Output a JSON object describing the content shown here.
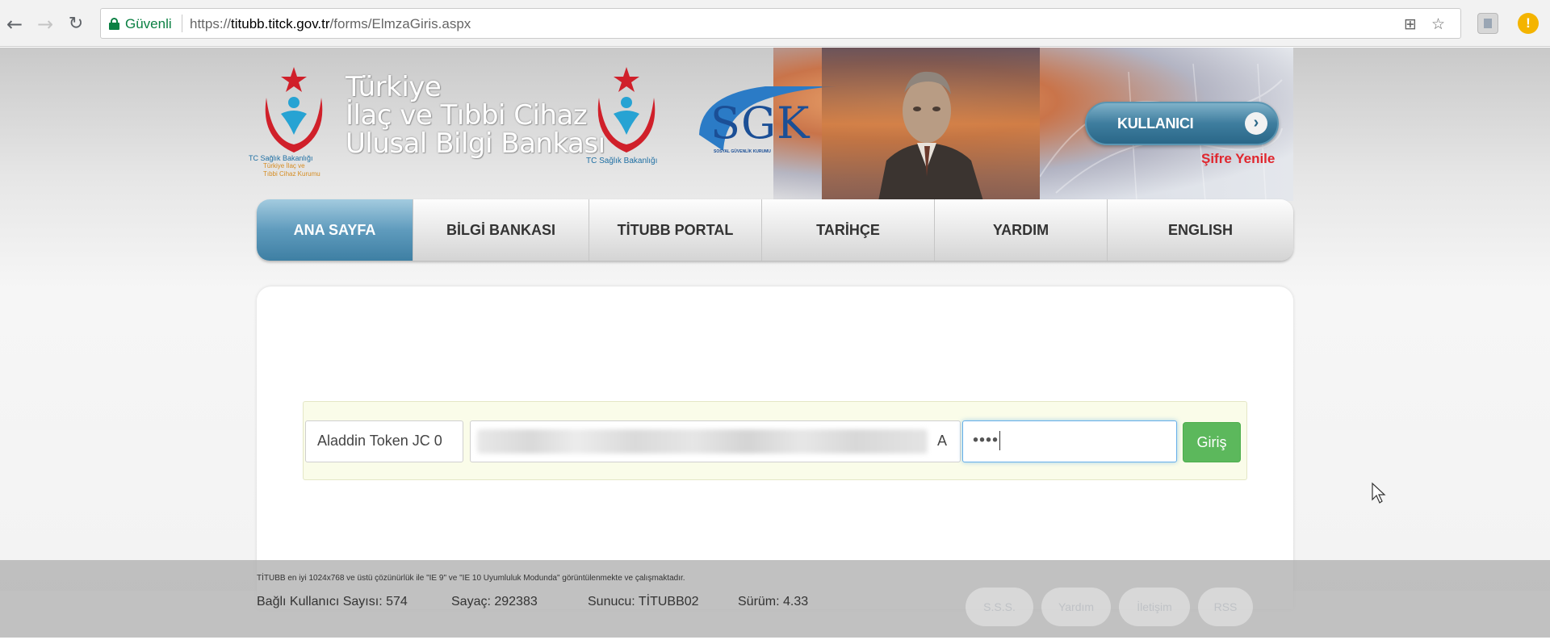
{
  "browser": {
    "secure_label": "Güvenli",
    "url_scheme": "https://",
    "url_host": "titubb.titck.gov.tr",
    "url_path": "/forms/ElmzaGiris.aspx"
  },
  "header": {
    "title_line1": "Türkiye",
    "title_line2": "İlaç ve Tıbbi Cihaz",
    "title_line3": "Ulusal Bilgi Bankası",
    "ministry_caption": "TC Sağlık Bakanlığı",
    "ministry_sub1": "Türkiye İlaç ve",
    "ministry_sub2": "Tıbbi Cihaz Kurumu",
    "ministry_caption2": "TC Sağlık Bakanlığı",
    "sgk_logo": "SGK",
    "sgk_sub": "SOSYAL GÜVENLİK KURUMU",
    "user_button": "KULLANICI",
    "reset_link": "Şifre Yenile"
  },
  "nav": {
    "items": [
      "ANA SAYFA",
      "BİLGİ BANKASI",
      "TİTUBB PORTAL",
      "TARİHÇE",
      "YARDIM",
      "ENGLISH"
    ]
  },
  "login": {
    "token_value": "Aladdin Token JC 0",
    "certificate_tail": "A",
    "pin_value": "••••",
    "submit_label": "Giriş"
  },
  "footer": {
    "note": "TİTUBB en iyi 1024x768 ve üstü çözünürlük ile \"IE 9\" ve \"IE 10 Uyumluluk Modunda\" görüntülenmekte ve çalışmaktadır.",
    "connected_users": "Bağlı Kullanıcı Sayısı: 574",
    "counter": "Sayaç: 292383",
    "server": "Sunucu: TİTUBB02",
    "version": "Sürüm: 4.33",
    "links": [
      "S.S.S.",
      "Yardım",
      "İletişim",
      "RSS"
    ]
  },
  "colors": {
    "nav_active": "#3e7fa3",
    "login_button": "#5cb85c",
    "reset_link": "#e0262e",
    "secure_green": "#0b8043"
  }
}
